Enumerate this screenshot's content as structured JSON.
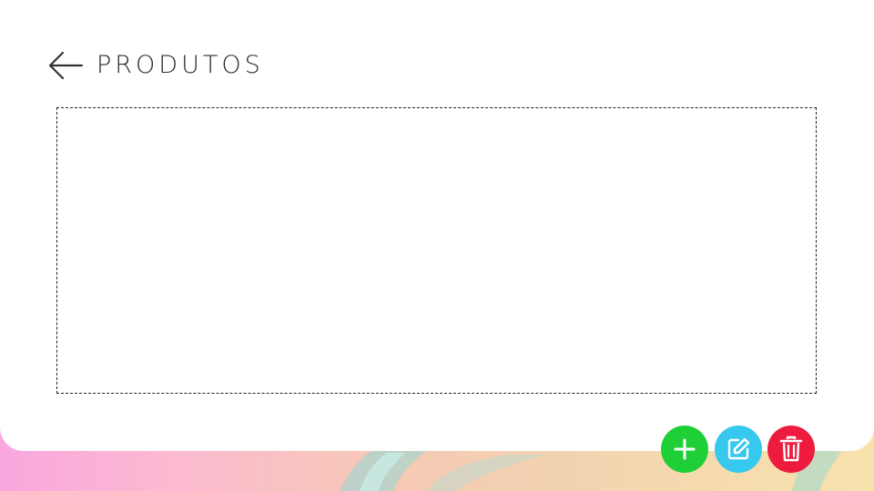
{
  "header": {
    "title": "PRODUTOS",
    "back_icon": "arrow-left-icon"
  },
  "actions": {
    "add": {
      "icon": "plus-icon",
      "color": "#1fcf37"
    },
    "edit": {
      "icon": "edit-icon",
      "color": "#36c8ee"
    },
    "delete": {
      "icon": "trash-icon",
      "color": "#ed1c3f"
    }
  },
  "colors": {
    "card_background": "#ffffff",
    "text": "#2b2b2b",
    "background_gradient": [
      "#f9a7de",
      "#f6c9b4",
      "#f8e2ac"
    ]
  }
}
